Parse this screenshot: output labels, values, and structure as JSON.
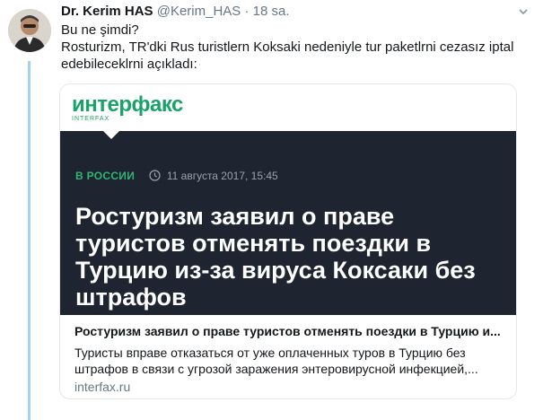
{
  "tweet": {
    "author_name": "Dr. Kerim HAS",
    "handle": "@Kerim_HAS",
    "separator": "·",
    "time": "18 sa.",
    "text_line1": "Bu ne şimdi?",
    "text_line2": "Rosturizm, TR'dki Rus turistlern Koksaki nedeniyle tur paketlrni cezasız iptal edebileceklrni açıkladı:"
  },
  "card": {
    "logo_text": "интерфакс",
    "logo_sub": "INTERFAX",
    "category": "В РОССИИ",
    "date": "11 августа 2017, 15:45",
    "headline": "Ростуризм заявил о праве туристов отменять поездки в Турцию из-за вируса Коксаки без штрафов",
    "title": "Ростуризм заявил о праве туристов отменять поездки в Турцию и...",
    "description": "Туристы вправе отказаться от уже оплаченных туров в Турцию без штрафов в связи с угрозой заражения энтеровирусной инфекцией,...",
    "domain": "interfax.ru"
  },
  "colors": {
    "thread_line": "#a6d2ee",
    "brand_green": "#1aa26a",
    "image_bg": "#1e2430"
  },
  "icons": {
    "menu": "chevron-down-icon",
    "clock": "clock-icon"
  }
}
